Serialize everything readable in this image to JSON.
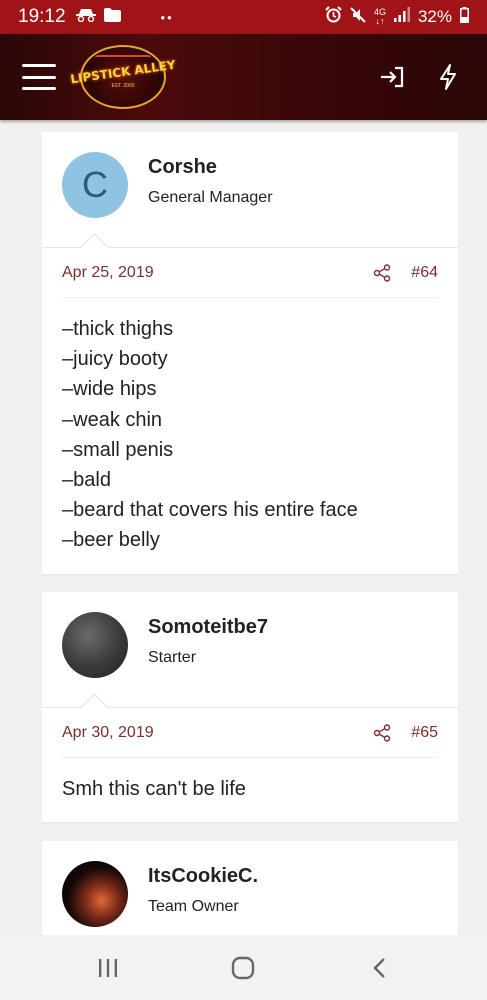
{
  "status_bar": {
    "time": "19:12",
    "battery": "32%",
    "network": "4G"
  },
  "app_bar": {
    "logo_text": "LIPSTICK ALLEY",
    "logo_est": "EST. 2000"
  },
  "posts": [
    {
      "username": "Corshe",
      "user_title": "General Manager",
      "avatar_letter": "C",
      "date": "Apr 25, 2019",
      "post_number": "#64",
      "lines": [
        "–thick thighs",
        "–juicy booty",
        "–wide hips",
        "–weak chin",
        "–small penis",
        "–bald",
        "–beard that covers his entire face",
        "–beer belly"
      ]
    },
    {
      "username": "Somoteitbe7",
      "user_title": "Starter",
      "date": "Apr 30, 2019",
      "post_number": "#65",
      "lines": [
        "Smh this can't be life"
      ]
    },
    {
      "username": "ItsCookieC.",
      "user_title": "Team Owner"
    }
  ],
  "colors": {
    "status_bar": "#a01417",
    "app_bar": "#3b0708",
    "meta_text": "#7a2e2e",
    "avatar_letter_bg": "#8fc3e2"
  },
  "icons": {
    "login": "login-icon",
    "whats_new": "lightning-icon",
    "share": "share-icon",
    "nav_recents": "recents-icon",
    "nav_home": "home-icon",
    "nav_back": "back-icon"
  }
}
